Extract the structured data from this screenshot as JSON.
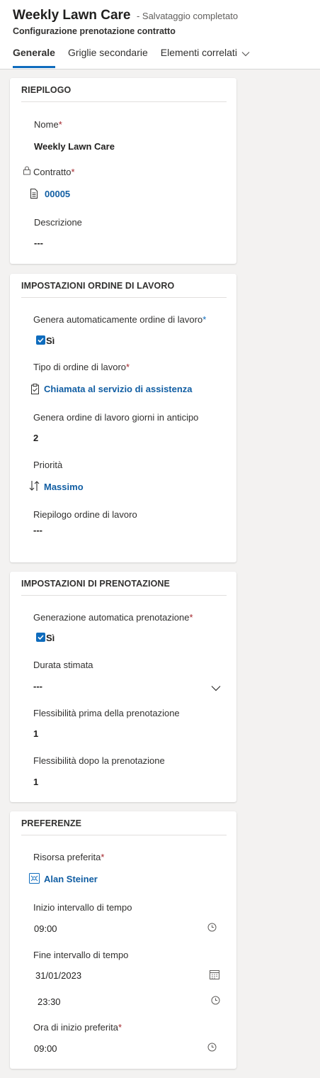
{
  "header": {
    "title": "Weekly Lawn Care",
    "save_status": "- Salvataggio completato",
    "subtitle": "Configurazione prenotazione contratto",
    "tabs": [
      {
        "label": "Generale",
        "active": true
      },
      {
        "label": "Griglie secondarie",
        "active": false
      },
      {
        "label": "Elementi correlati",
        "active": false
      }
    ]
  },
  "summary": {
    "title": "RIEPILOGO",
    "name_label": "Nome",
    "name_value": "Weekly Lawn Care",
    "contract_label": "Contratto",
    "contract_value": "00005",
    "description_label": "Descrizione",
    "description_value": "---"
  },
  "work_order": {
    "title": "IMPOSTAZIONI ORDINE DI LAVORO",
    "auto_generate_label": "Genera automaticamente ordine di lavoro",
    "auto_generate_value": "Sì",
    "type_label": "Tipo di ordine di lavoro",
    "type_value": "Chiamata al servizio di assistenza",
    "days_in_advance_label": "Genera ordine di lavoro giorni in anticipo",
    "days_in_advance_value": "2",
    "priority_label": "Priorità",
    "priority_value": "Massimo",
    "summary_label": "Riepilogo ordine di lavoro",
    "summary_value": "---"
  },
  "booking": {
    "title": "IMPOSTAZIONI DI PRENOTAZIONE",
    "auto_booking_label": "Generazione automatica prenotazione",
    "auto_booking_value": "Sì",
    "duration_label": "Durata stimata",
    "duration_value": "---",
    "flex_before_label": "Flessibilità prima della prenotazione",
    "flex_before_value": "1",
    "flex_after_label": "Flessibilità dopo la prenotazione",
    "flex_after_value": "1"
  },
  "preferences": {
    "title": "PREFERENZE",
    "resource_label": "Risorsa preferita",
    "resource_value": "Alan Steiner",
    "window_start_label": "Inizio intervallo di tempo",
    "window_start_value": "09:00",
    "window_end_label": "Fine intervallo di tempo",
    "window_end_date": "31/01/2023",
    "window_end_time": "23:30",
    "start_time_label": "Ora di inizio preferita",
    "start_time_value": "09:00"
  },
  "icons": {
    "lock": "lock-icon",
    "contract": "document-icon",
    "work_order_type": "clipboard-icon",
    "priority": "sort-arrows-icon",
    "resource": "resource-icon",
    "clock": "clock-icon",
    "calendar": "calendar-icon",
    "chevron": "chevron-down-icon"
  },
  "colors": {
    "accent": "#0f6cbd",
    "link": "#115ea3",
    "required": "#a4262c"
  }
}
